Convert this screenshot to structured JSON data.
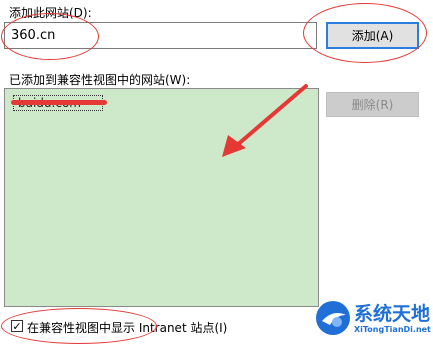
{
  "dialog": {
    "add_label": "添加此网站(D):",
    "site_input_value": "360.cn",
    "add_button": "添加(A)",
    "list_label": "已添加到兼容性视图中的网站(W):",
    "remove_button": "删除(R)",
    "list_items": [
      "baidu.com"
    ],
    "intranet_checkbox_checked": true,
    "intranet_checkbox_mark": "✓",
    "intranet_label": "在兼容性视图中显示 Intranet 站点(I)"
  },
  "watermark": {
    "title": "系统天地",
    "subtitle": "XiTongTianDi.net"
  },
  "colors": {
    "annotation_red": "#e53935",
    "list_background": "#cde9c9",
    "button_focus_border": "#2b7de0",
    "logo_blue": "#1f6fd6"
  },
  "icons": {
    "annotation_arrow": "red-arrow-icon",
    "checkbox": "check-icon",
    "logo": "xitongtiandi-logo-icon"
  }
}
